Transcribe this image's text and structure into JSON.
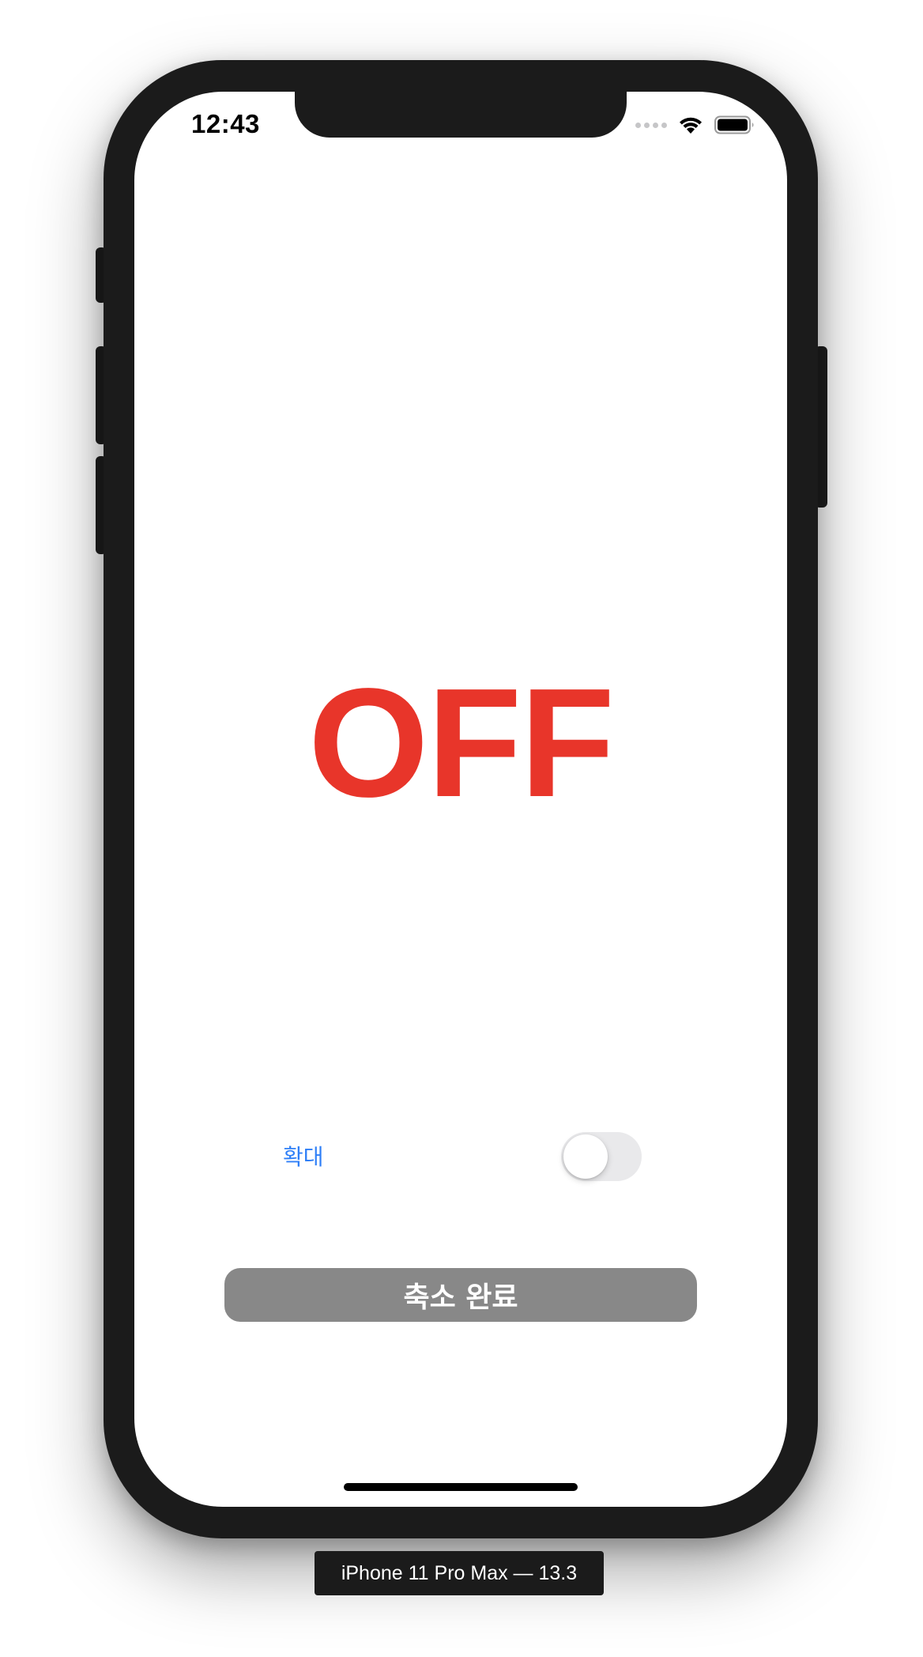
{
  "status_bar": {
    "time": "12:43",
    "icons": [
      "signal-dots-icon",
      "wifi-icon",
      "battery-icon"
    ]
  },
  "main": {
    "state_text": "OFF",
    "state_color": "#e8352a",
    "zoom_label": "확대",
    "zoom_toggle_on": false,
    "done_button_label": "축소 완료",
    "done_button_color": "#888888",
    "accent_color": "#2f7ff7"
  },
  "simulator": {
    "caption": "iPhone 11 Pro Max — 13.3"
  }
}
